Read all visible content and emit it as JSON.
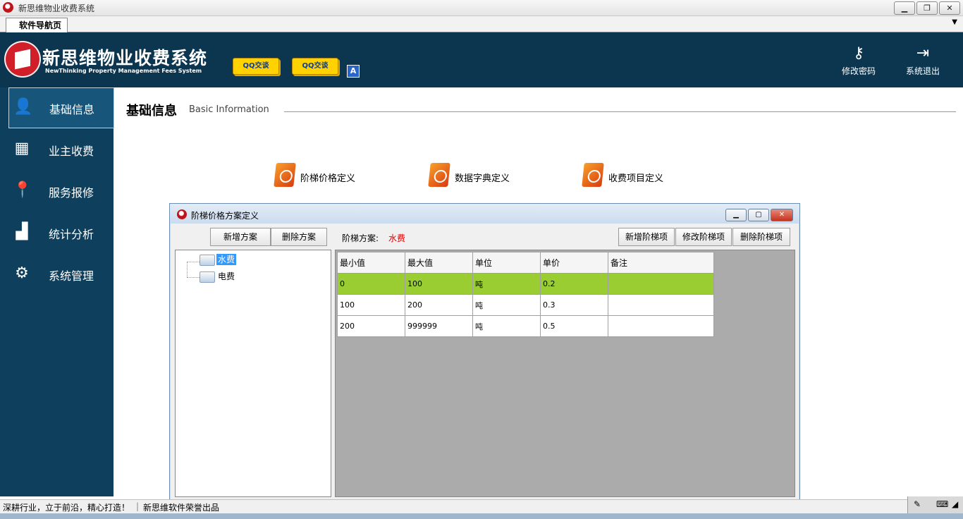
{
  "window": {
    "title": "新思维物业收费系统"
  },
  "tabs": [
    {
      "label": "软件导航页"
    }
  ],
  "brand": {
    "title": "新思维物业收费系统",
    "subtitle": "NewThinking  Property Management Fees System"
  },
  "header": {
    "qq_buttons": [
      {
        "label": "QQ交谈"
      },
      {
        "label": "QQ交谈"
      }
    ],
    "a_badge": "A",
    "actions": [
      {
        "label": "修改密码",
        "icon": "key-icon"
      },
      {
        "label": "系统退出",
        "icon": "exit-icon"
      }
    ]
  },
  "sidebar": {
    "items": [
      {
        "label": "基础信息",
        "icon": "user-icon",
        "active": true
      },
      {
        "label": "业主收费",
        "icon": "calendar-icon"
      },
      {
        "label": "服务报修",
        "icon": "location-pin-icon"
      },
      {
        "label": "统计分析",
        "icon": "bar-chart-icon"
      },
      {
        "label": "系统管理",
        "icon": "gear-icon"
      }
    ]
  },
  "page": {
    "title": "基础信息",
    "title_en": "Basic Information",
    "functions": [
      {
        "label": "阶梯价格定义"
      },
      {
        "label": "数据字典定义"
      },
      {
        "label": "收费项目定义"
      }
    ]
  },
  "dialog": {
    "title": "阶梯价格方案定义",
    "buttons_left": [
      "新增方案",
      "删除方案"
    ],
    "scheme_label": "阶梯方案:",
    "scheme_value": "水费",
    "buttons_right": [
      "新增阶梯项",
      "修改阶梯项",
      "删除阶梯项"
    ],
    "tree": [
      {
        "label": "水费",
        "selected": true
      },
      {
        "label": "电费"
      }
    ],
    "grid": {
      "columns": [
        "最小值",
        "最大值",
        "单位",
        "单价",
        "备注"
      ],
      "rows": [
        [
          "0",
          "100",
          "吨",
          "0.2",
          ""
        ],
        [
          "100",
          "200",
          "吨",
          "0.3",
          ""
        ],
        [
          "200",
          "999999",
          "吨",
          "0.5",
          ""
        ]
      ],
      "highlight_color": "#9acd32"
    }
  },
  "status": {
    "left": "深耕行业，立于前沿，精心打造！",
    "right": "新思维软件荣誉出品"
  },
  "colors": {
    "header_bg": "#0c3650",
    "sidebar_bg": "#0e3f5c",
    "accent_red": "#d01f28"
  }
}
